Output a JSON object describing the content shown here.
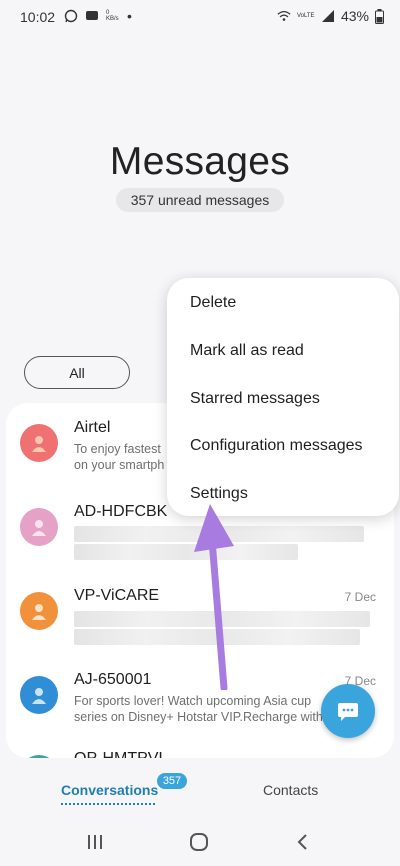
{
  "status_bar": {
    "time": "10:02",
    "network_speed": "0 KB/s",
    "network_label": "VoLTE",
    "battery": "43%"
  },
  "header": {
    "title": "Messages",
    "unread_count": "357 unread messages"
  },
  "filter": {
    "label": "All"
  },
  "conversations": [
    {
      "name": "Airtel",
      "date": "",
      "preview": "To enjoy fastest",
      "preview_line2": "on your smartph",
      "avatar_color": "#f07171"
    },
    {
      "name": "AD-HDFCBK",
      "date": "",
      "preview": "",
      "avatar_color": "#e5a1c6"
    },
    {
      "name": "VP-ViCARE",
      "date": "7 Dec",
      "preview": "",
      "avatar_color": "#f1913b"
    },
    {
      "name": "AJ-650001",
      "date": "7 Dec",
      "preview": "For sports lover! Watch upcoming Asia cup",
      "preview_line2": "series on Disney+ Hotstar VIP.Recharge with",
      "avatar_color": "#2f8ed6"
    },
    {
      "name": "QP-HMTPVL",
      "date": "",
      "preview": "",
      "avatar_color": "#3aa59a"
    }
  ],
  "menu": {
    "items": [
      "Delete",
      "Mark all as read",
      "Starred messages",
      "Configuration messages",
      "Settings"
    ]
  },
  "tabs": {
    "conversations": "Conversations",
    "conversations_badge": "357",
    "contacts": "Contacts"
  },
  "colors": {
    "accent": "#1f7fb3",
    "fab": "#3aa5dc",
    "arrow": "#a77be0"
  }
}
